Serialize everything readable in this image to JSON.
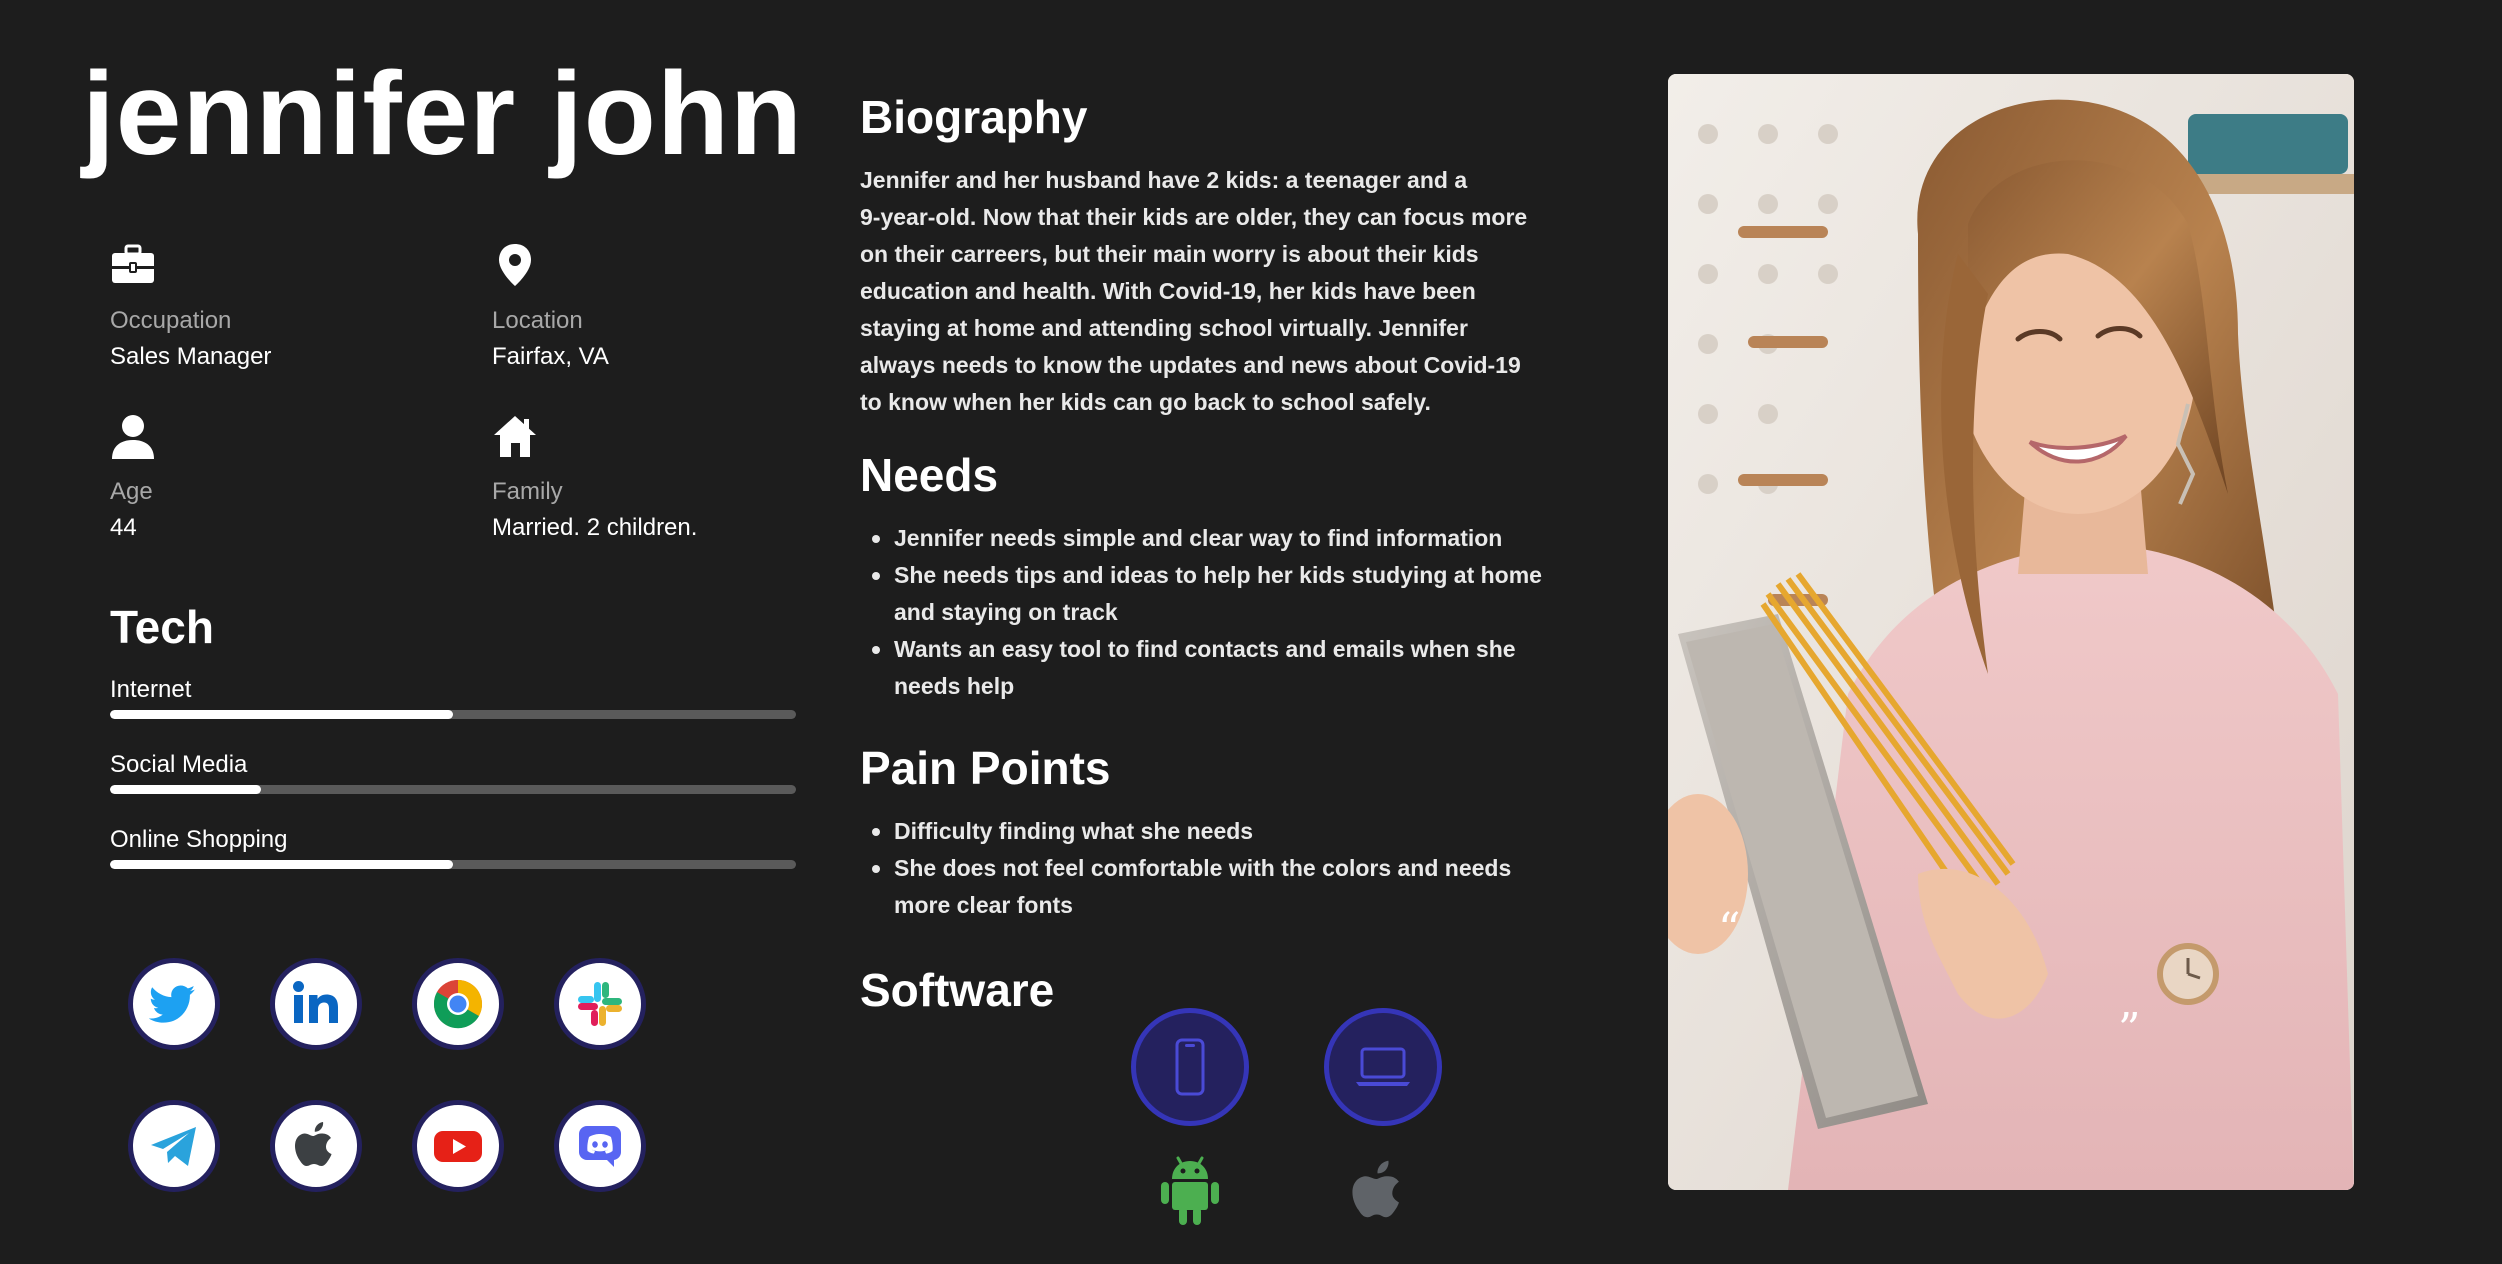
{
  "persona": {
    "name": "jennifer john"
  },
  "info": {
    "occupation": {
      "label": "Occupation",
      "value": "Sales Manager",
      "icon": "briefcase-icon"
    },
    "location": {
      "label": "Location",
      "value": "Fairfax, VA",
      "icon": "location-pin-icon"
    },
    "age": {
      "label": "Age",
      "value": "44",
      "icon": "user-icon"
    },
    "family": {
      "label": "Family",
      "value": "Married. 2 children.",
      "icon": "home-icon"
    }
  },
  "tech": {
    "title": "Tech",
    "items": [
      {
        "label": "Internet",
        "level": 0.5
      },
      {
        "label": "Social Media",
        "level": 0.22
      },
      {
        "label": "Online Shopping",
        "level": 0.5
      }
    ]
  },
  "social_apps": [
    "twitter-icon",
    "linkedin-icon",
    "chrome-icon",
    "slack-icon",
    "telegram-icon",
    "apple-icon",
    "youtube-icon",
    "discord-icon"
  ],
  "biography": {
    "title": "Biography",
    "lines": [
      "Jennifer and her husband have 2 kids: a teenager and a",
      "9-year-old. Now that their kids are older, they can focus more",
      "on their carreers, but their main worry is about their kids",
      "education and health. With Covid-19, her kids have been",
      "staying at home and attending school virtually.  Jennifer",
      "always needs to know the updates and  news about Covid-19",
      "to know when her kids can go back to school safely."
    ]
  },
  "needs": {
    "title": "Needs",
    "items": [
      {
        "lines": [
          "Jennifer needs simple and clear way to find  information"
        ]
      },
      {
        "lines": [
          "She needs tips and ideas to help her kids studying at home",
          "and staying on track"
        ]
      },
      {
        "lines": [
          "Wants an easy tool to find contacts and emails when she",
          "needs help"
        ]
      }
    ]
  },
  "pain_points": {
    "title": "Pain Points",
    "items": [
      {
        "lines": [
          "Difficulty finding what she needs"
        ]
      },
      {
        "lines": [
          "She does not feel comfortable with the colors and needs",
          "more clear fonts"
        ]
      }
    ]
  },
  "software": {
    "title": "Software",
    "devices": [
      "mobile-phone-icon",
      "laptop-icon"
    ],
    "platforms": [
      "android-icon",
      "apple-icon"
    ]
  },
  "photo": {
    "open_quote": "“",
    "close_quote": "”"
  },
  "colors": {
    "background": "#1d1d1d",
    "device_fill": "#24215e",
    "device_border": "#3535b8",
    "android_green": "#4caf50",
    "apple_gray": "#5f6368"
  }
}
